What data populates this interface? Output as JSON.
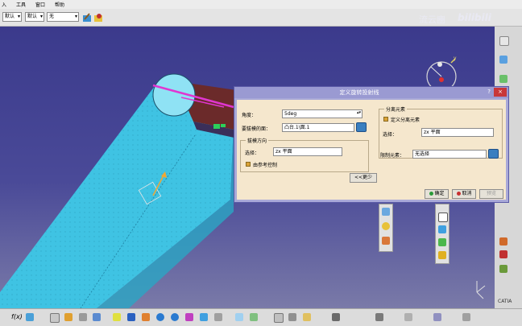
{
  "menubar": {
    "items": [
      "入",
      "工具",
      "窗口",
      "帮助"
    ]
  },
  "toolbar": {
    "combo1": "默认",
    "combo2": "默认",
    "combo3": "无"
  },
  "watermark": {
    "text": "流云豳",
    "brand": "bilibili"
  },
  "dialog": {
    "title": "定义旋转投射线",
    "help": "?",
    "close": "×",
    "angle_label": "角度：",
    "angle_value": "5deg",
    "surface_label": "要拔模的面：",
    "surface_value": "凸台.1\\面.1",
    "direction_group": "拔模方向",
    "select_label": "选择：",
    "direction_value": "zx 平面",
    "reference_control": "由参考控制",
    "split_group": "分离元素",
    "define_split": "定义分离元素",
    "split_select_label": "选择：",
    "split_value": "zx 平面",
    "limit_label": "限制元素：",
    "limit_value": "无选择",
    "less_button": "<<更少",
    "ok_button": "确定",
    "cancel_button": "取消",
    "preview_button": "预览"
  },
  "colors": {
    "viewport_top": "#3b3a8c",
    "dialog_bg": "#f5e7cd",
    "dialog_title": "#9a9ad2",
    "solid": "#3fc8e8",
    "accent_pink": "#e036d0"
  },
  "icons": [
    "f-of-x-icon",
    "sketch-icon",
    "pan-icon",
    "zoom-in-icon",
    "zoom-out-icon",
    "rotate-icon",
    "compass-icon",
    "axis-icon"
  ]
}
